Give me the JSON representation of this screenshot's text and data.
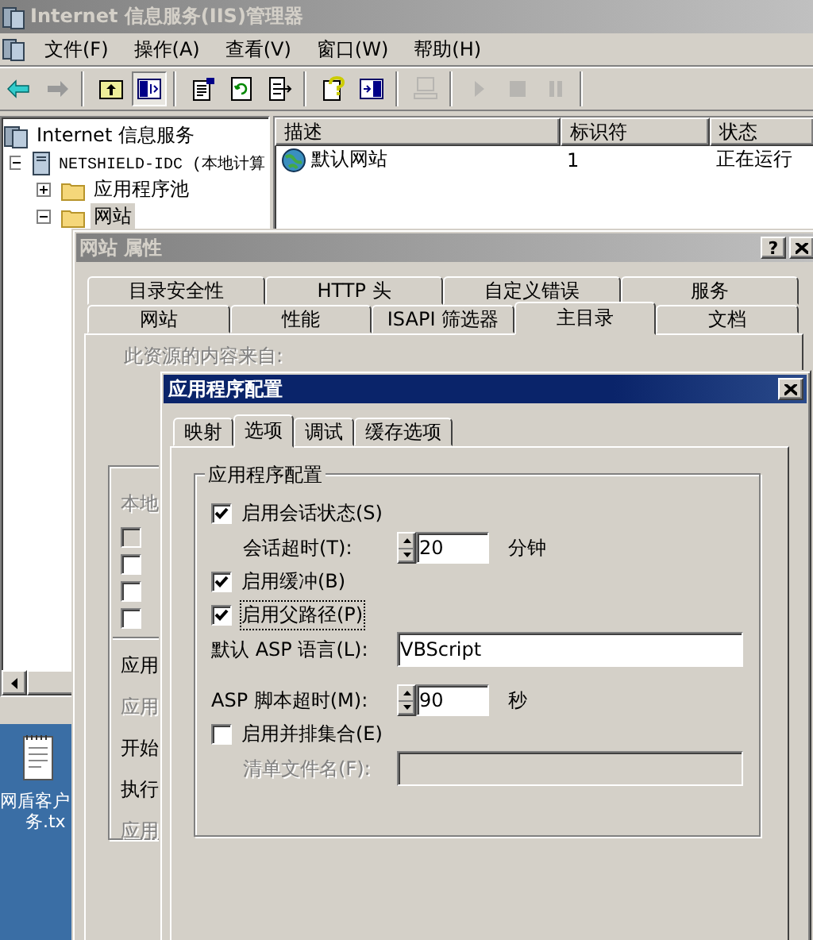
{
  "main_window": {
    "title": "Internet 信息服务(IIS)管理器",
    "menu": [
      "文件(F)",
      "操作(A)",
      "查看(V)",
      "窗口(W)",
      "帮助(H)"
    ],
    "toolbar_groups": [
      {
        "buttons": [
          {
            "kind": "back",
            "disabled": false,
            "pressed": false
          },
          {
            "kind": "forward",
            "disabled": false,
            "pressed": false
          }
        ]
      },
      {
        "buttons": [
          {
            "kind": "up",
            "disabled": false,
            "pressed": false
          },
          {
            "kind": "tree",
            "disabled": false,
            "pressed": true
          }
        ]
      },
      {
        "buttons": [
          {
            "kind": "properties",
            "disabled": false,
            "pressed": false
          },
          {
            "kind": "refresh",
            "disabled": false,
            "pressed": false
          },
          {
            "kind": "export",
            "disabled": false,
            "pressed": false
          }
        ]
      },
      {
        "buttons": [
          {
            "kind": "help",
            "disabled": false,
            "pressed": false
          },
          {
            "kind": "panel",
            "disabled": false,
            "pressed": false
          }
        ]
      },
      {
        "buttons": [
          {
            "kind": "computer",
            "disabled": true,
            "pressed": false
          }
        ]
      },
      {
        "buttons": [
          {
            "kind": "play",
            "disabled": true,
            "pressed": false
          },
          {
            "kind": "stop",
            "disabled": true,
            "pressed": false
          },
          {
            "kind": "pause",
            "disabled": true,
            "pressed": false
          }
        ]
      }
    ],
    "tree": [
      {
        "label": "Internet 信息服务",
        "kind": "root",
        "selected": false,
        "children": [
          {
            "label": "NETSHIELD-IDC (本地计算",
            "kind": "server",
            "expanded": true,
            "selected": false,
            "children": [
              {
                "label": "应用程序池",
                "kind": "folder",
                "expanded": false,
                "selected": false
              },
              {
                "label": "网站",
                "kind": "folder",
                "expanded": true,
                "selected": true
              }
            ]
          }
        ]
      }
    ],
    "list": {
      "columns": [
        "描述",
        "标识符",
        "状态"
      ],
      "rows": [
        {
          "kind": "site",
          "cells": [
            "默认网站",
            "1",
            "正在运行"
          ]
        }
      ]
    }
  },
  "desktop_file": {
    "label_lines": [
      "网盾客户",
      "务.tx"
    ]
  },
  "properties_dialog": {
    "title": "网站 属性",
    "help_button": "?",
    "tab_rows": [
      {
        "tabs": [
          {
            "label": "目录安全性",
            "selected": false
          },
          {
            "label": "HTTP 头",
            "selected": false
          },
          {
            "label": "自定义错误",
            "selected": false
          },
          {
            "label": "服务",
            "selected": false
          }
        ]
      },
      {
        "tabs": [
          {
            "label": "网站",
            "selected": false
          },
          {
            "label": "性能",
            "selected": false
          },
          {
            "label": "ISAPI 筛选器",
            "selected": false
          },
          {
            "label": "主目录",
            "selected": true
          },
          {
            "label": "文档",
            "selected": false
          }
        ]
      }
    ],
    "source_label": "此资源的内容来自:",
    "partial_items": [
      {
        "kind": "label",
        "label": "本地",
        "disabled": true
      },
      {
        "kind": "checkbox",
        "checked": false,
        "disabled": true
      },
      {
        "kind": "checkbox",
        "checked": false,
        "disabled": false
      },
      {
        "kind": "checkbox",
        "checked": false,
        "disabled": false
      },
      {
        "kind": "checkbox",
        "checked": false,
        "disabled": false
      },
      {
        "kind": "divider"
      },
      {
        "kind": "label",
        "label": "应用",
        "disabled": false
      },
      {
        "kind": "label",
        "label": "应用",
        "disabled": true
      },
      {
        "kind": "label",
        "label": "开始",
        "disabled": false
      },
      {
        "kind": "label",
        "label": "执行",
        "disabled": false
      },
      {
        "kind": "label",
        "label": "应用",
        "disabled": true
      }
    ]
  },
  "config_dialog": {
    "title": "应用程序配置",
    "tabs": [
      {
        "label": "映射",
        "selected": false
      },
      {
        "label": "选项",
        "selected": true
      },
      {
        "label": "调试",
        "selected": false
      },
      {
        "label": "缓存选项",
        "selected": false
      }
    ],
    "group_title": "应用程序配置",
    "items": [
      {
        "kind": "checkbox",
        "label": "启用会话状态(S)",
        "checked": true,
        "focused": false,
        "children": [
          {
            "kind": "spinner",
            "label": "会话超时(T):",
            "value": "20",
            "unit": "分钟"
          }
        ]
      },
      {
        "kind": "checkbox",
        "label": "启用缓冲(B)",
        "checked": true,
        "focused": false
      },
      {
        "kind": "checkbox",
        "label": "启用父路径(P)",
        "checked": true,
        "focused": true
      },
      {
        "kind": "text",
        "label": "默认 ASP 语言(L):",
        "value": "VBScript",
        "disabled": false
      },
      {
        "kind": "spinner",
        "label": "ASP 脚本超时(M):",
        "value": "90",
        "unit": "秒"
      },
      {
        "kind": "checkbox",
        "label": "启用并排集合(E)",
        "checked": false,
        "focused": false,
        "children": [
          {
            "kind": "text",
            "label": "清单文件名(F):",
            "disabled": true
          }
        ]
      }
    ]
  }
}
